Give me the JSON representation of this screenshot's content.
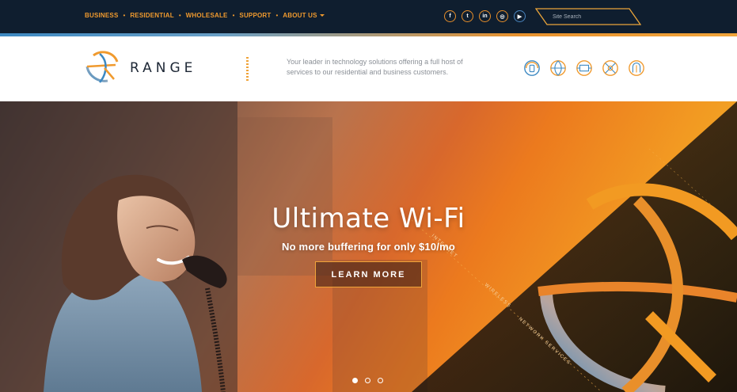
{
  "nav": {
    "items": [
      {
        "label": "BUSINESS"
      },
      {
        "label": "RESIDENTIAL"
      },
      {
        "label": "WHOLESALE"
      },
      {
        "label": "SUPPORT"
      },
      {
        "label": "ABOUT US"
      }
    ]
  },
  "social": {
    "icons": [
      "facebook-icon",
      "twitter-icon",
      "linkedin-icon",
      "instagram-icon",
      "youtube-icon"
    ],
    "glyphs": [
      "f",
      "t",
      "in",
      "◎",
      "▶"
    ]
  },
  "search": {
    "placeholder": "Site Search"
  },
  "brand": {
    "name": "RANGE",
    "tagline": "Your leader in technology solutions offering a full host of services to our residential and business customers.",
    "colors": {
      "orange": "#f09a2e",
      "navy": "#0f1e2f",
      "blue": "#3d89c2"
    }
  },
  "service_icons": [
    "phone-service-icon",
    "internet-service-icon",
    "tv-service-icon",
    "wireless-service-icon",
    "network-service-icon"
  ],
  "hero": {
    "title": "Ultimate Wi-Fi",
    "subtitle": "No more buffering for only $10/mo",
    "cta_label": "LEARN MORE",
    "diagonal_words": [
      "INTERNET",
      "WIRELESS",
      "NETWORK SERVICES"
    ],
    "slides": 3,
    "active_slide": 1
  }
}
